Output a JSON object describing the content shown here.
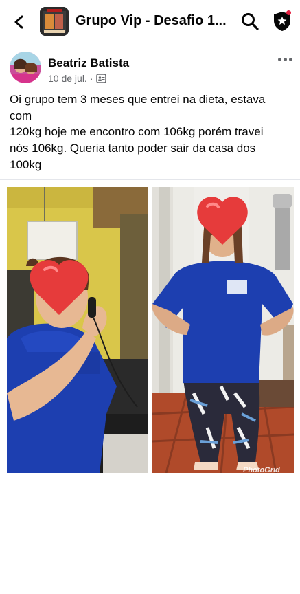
{
  "header": {
    "title": "Grupo Vip - Desafio 1...",
    "back_icon": "chevron-left-icon",
    "search_icon": "search-icon",
    "shield_icon": "shield-star-icon"
  },
  "post": {
    "author": "Beatriz Batista",
    "date": "10 de jul.",
    "dot": "·",
    "audience_icon": "group-members-icon",
    "text_lines": [
      "Oi grupo tem 3 meses que entrei na dieta, estava",
      "com",
      "120kg hoje me encontro com 106kg porém travei",
      "nós 106kg. Queria tanto poder sair da casa dos",
      "100kg"
    ]
  },
  "collage": {
    "watermark": "PhotoGrid"
  },
  "colors": {
    "accent_red": "#e41e3f",
    "text_primary": "#050505",
    "text_secondary": "#65676b",
    "shirt_blue": "#1d3fb0"
  }
}
